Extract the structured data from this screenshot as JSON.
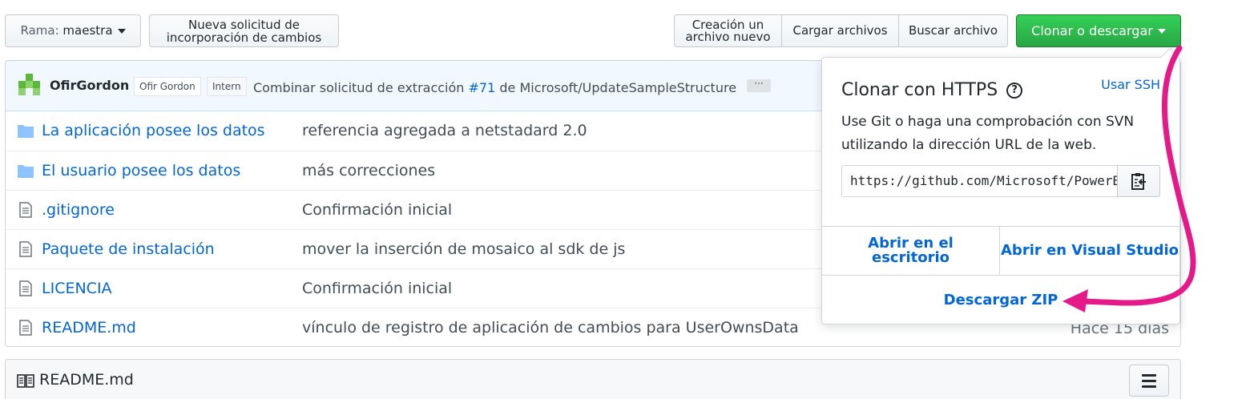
{
  "toolbar": {
    "branch_prefix": "Rama:",
    "branch_name": "maestra",
    "new_pr_line1": "Nueva solicitud de",
    "new_pr_line2": "incorporación de cambios",
    "create_file_line1": "Creación un",
    "create_file_line2": "archivo nuevo",
    "upload_files": "Cargar archivos",
    "find_file": "Buscar archivo",
    "clone_download": "Clonar o descargar"
  },
  "commit": {
    "author": "OfirGordon",
    "badge_name": "Ofir Gordon",
    "badge_role": "Intern",
    "message_prefix": "Combinar solicitud de extracción",
    "pr_link": "#71",
    "message_suffix": "de Microsoft/UpdateSampleStructure",
    "ellipsis": "···"
  },
  "files": [
    {
      "type": "folder",
      "name": "La aplicación posee los datos",
      "message": "referencia agregada a netstadard 2.0",
      "age": ""
    },
    {
      "type": "folder",
      "name": "El usuario posee los datos",
      "message": "más correcciones",
      "age": ""
    },
    {
      "type": "file",
      "name": ".gitignore",
      "message": "Confirmación inicial",
      "age": ""
    },
    {
      "type": "file",
      "name": "Paquete de instalación",
      "message": "mover la inserción de mosaico al sdk de js",
      "age": ""
    },
    {
      "type": "file",
      "name": "LICENCIA",
      "message": "Confirmación inicial",
      "age": ""
    },
    {
      "type": "file",
      "name": "README.md",
      "message": "vínculo de registro de aplicación de cambios para UserOwnsData",
      "age": "Hace 15 días"
    }
  ],
  "readme": {
    "title": "README.md"
  },
  "clone_dropdown": {
    "title": "Clonar con HTTPS",
    "help": "?",
    "use_ssh": "Usar SSH",
    "description": "Use Git o haga una comprobación con SVN utilizando la dirección URL de la web.",
    "url": "https://github.com/Microsoft/PowerBI-Developer-Samples.git",
    "open_desktop_line1": "Abrir en el",
    "open_desktop_line2": "escritorio",
    "open_visual_studio": "Abrir en Visual Studio",
    "download_zip": "Descargar ZIP"
  },
  "colors": {
    "link": "#0366d6",
    "green_button": "#28a745",
    "annotation_arrow": "#e6198a"
  }
}
